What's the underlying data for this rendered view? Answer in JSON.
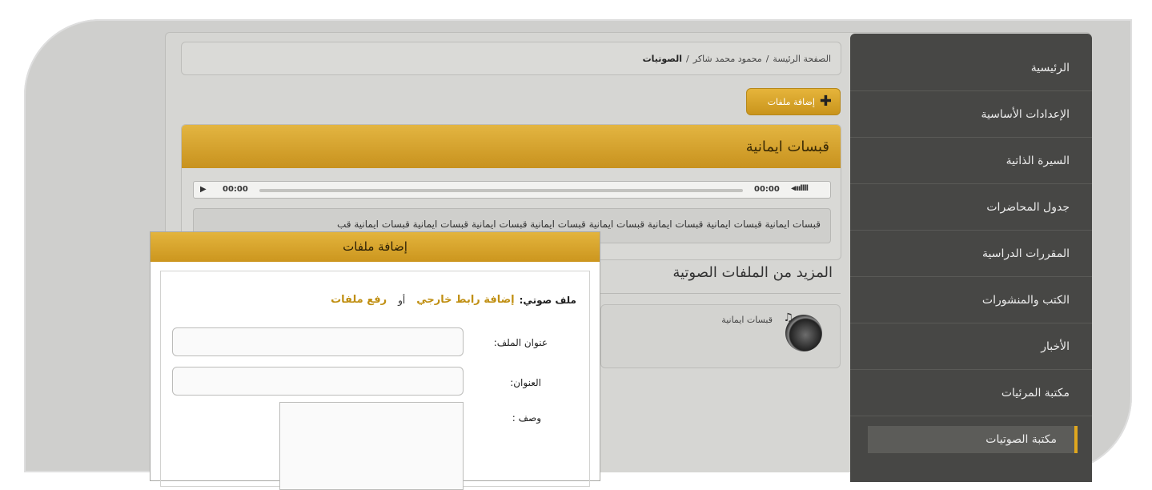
{
  "sidebar": {
    "items": [
      {
        "label": "الرئيسية"
      },
      {
        "label": "الإعدادات الأساسية"
      },
      {
        "label": "السيرة الذاتية"
      },
      {
        "label": "جدول المحاضرات"
      },
      {
        "label": "المقررات الدراسية"
      },
      {
        "label": "الكتب والمنشورات"
      },
      {
        "label": "الأخبار"
      },
      {
        "label": "مكتبة المرئيات"
      },
      {
        "label": "مكتبة الصوتيات"
      }
    ],
    "active": "مكتبة الصوتيات"
  },
  "breadcrumb": {
    "home": "الصفحة الرئيسة",
    "sep1": "/",
    "user": "محمود محمد شاكر",
    "sep2": "/",
    "current": "الصوتيات"
  },
  "add_button": {
    "label": "إضافة ملفات",
    "icon": "plus-icon"
  },
  "audio_card": {
    "title": "قبسات ايمانية",
    "player": {
      "time_current": "00:00",
      "time_total": "00:00"
    },
    "description": "قبسات ايمانية قبسات ايمانية قبسات ايمانية قبسات ايمانية قبسات ايمانية قبسات ايمانية قبسات ايمانية قبسات ايمانية قب"
  },
  "more": {
    "title": "المزيد من الملفات الصوتية",
    "items": [
      {
        "label": "قبسات ايمانية",
        "icon": "speaker-icon"
      }
    ]
  },
  "modal": {
    "title": "إضافة ملفات",
    "source_label": "ملف صوتي:",
    "link_external": "إضافة رابط خارجي",
    "or": "أو",
    "link_upload": "رفع ملفات",
    "file_title_label": "عنوان الملف:",
    "title_label": "العنوان:",
    "desc_label": "وصف :"
  },
  "colors": {
    "accent": "#d9a52c",
    "sidebar": "#474745",
    "link": "#c08f12"
  }
}
